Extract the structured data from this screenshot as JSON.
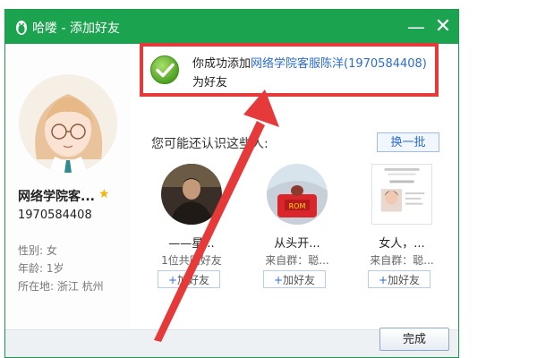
{
  "window": {
    "title": "哈喽 - 添加好友",
    "minimize_glyph": "—",
    "close_glyph": "✕",
    "accent_color": "#1ca34f"
  },
  "profile": {
    "nickname": "网络学院客...",
    "qq_number": "1970584408",
    "gender": "性别: 女",
    "age": "年龄: 1岁",
    "location": "所在地: 浙江  杭州"
  },
  "success": {
    "prefix": "你成功添加",
    "friend": "网络学院客服陈洋(1970584408)",
    "suffix": "为好友",
    "highlight_color": "#e5393a"
  },
  "suggestions": {
    "label": "您可能还认识这些人:",
    "refresh_label": "换一批",
    "add_label": "加好友",
    "people": [
      {
        "name": "——星...",
        "sub": "1位共同好友"
      },
      {
        "name": "从头开...",
        "sub": "来自群：聪..."
      },
      {
        "name": "女人，...",
        "sub": "来自群：聪..."
      }
    ]
  },
  "footer": {
    "done_label": "完成"
  },
  "icons": [
    "penguin-icon",
    "success-check-icon",
    "star-icon",
    "plus-icon",
    "red-arrow"
  ]
}
